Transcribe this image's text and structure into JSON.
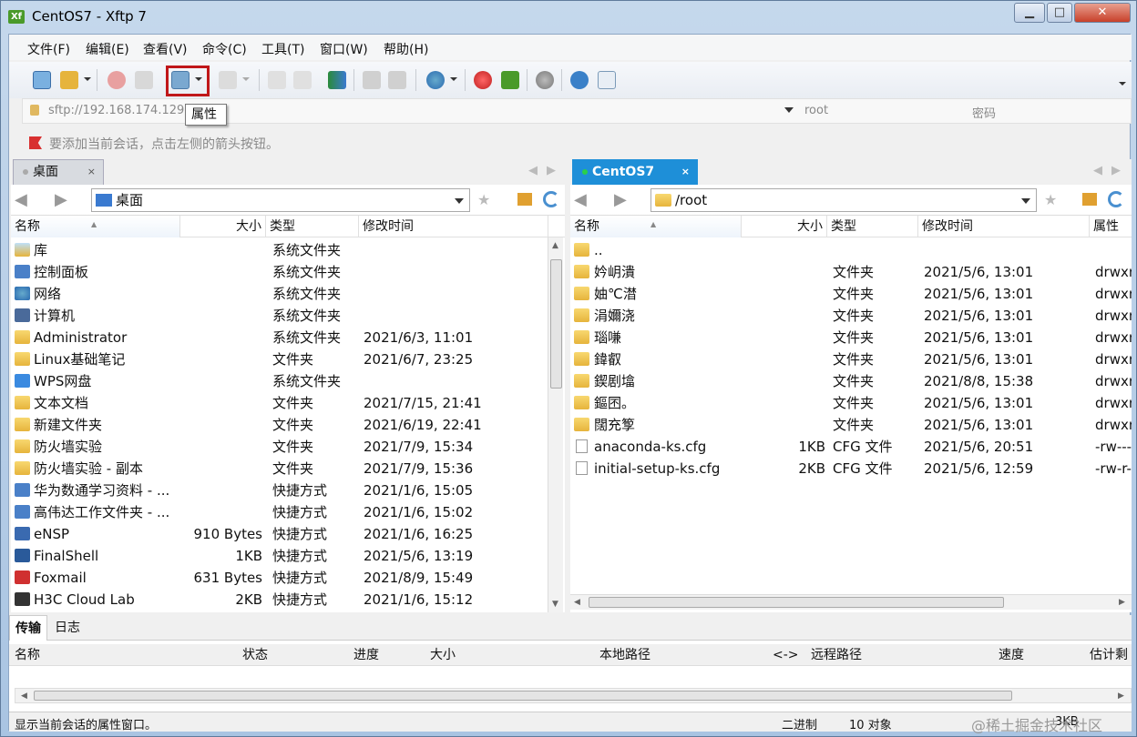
{
  "window": {
    "title": "CentOS7 - Xftp 7",
    "icon_text": "Xf",
    "min": "▁",
    "max": "□",
    "close": "✕"
  },
  "menu": [
    "文件(F)",
    "编辑(E)",
    "查看(V)",
    "命令(C)",
    "工具(T)",
    "窗口(W)",
    "帮助(H)"
  ],
  "tooltip": "属性",
  "address": {
    "host": "sftp://192.168.174.129",
    "user_placeholder": "root",
    "password_placeholder": "密码"
  },
  "info_text": "要添加当前会话，点击左侧的箭头按钮。",
  "left": {
    "tab": {
      "label": "桌面",
      "close": "×"
    },
    "path": "桌面",
    "columns": [
      "名称",
      "大小",
      "类型",
      "修改时间"
    ],
    "rows": [
      {
        "name": "库",
        "size": "",
        "type": "系统文件夹",
        "modified": "",
        "icon": "library-icon"
      },
      {
        "name": "控制面板",
        "size": "",
        "type": "系统文件夹",
        "modified": "",
        "icon": "control-panel-icon"
      },
      {
        "name": "网络",
        "size": "",
        "type": "系统文件夹",
        "modified": "",
        "icon": "network-icon"
      },
      {
        "name": "计算机",
        "size": "",
        "type": "系统文件夹",
        "modified": "",
        "icon": "computer-icon"
      },
      {
        "name": "Administrator",
        "size": "",
        "type": "系统文件夹",
        "modified": "2021/6/3, 11:01",
        "icon": "user-folder-icon"
      },
      {
        "name": "Linux基础笔记",
        "size": "",
        "type": "文件夹",
        "modified": "2021/6/7, 23:25",
        "icon": "folder-icon"
      },
      {
        "name": "WPS网盘",
        "size": "",
        "type": "系统文件夹",
        "modified": "",
        "icon": "cloud-icon"
      },
      {
        "name": "文本文档",
        "size": "",
        "type": "文件夹",
        "modified": "2021/7/15, 21:41",
        "icon": "folder-icon"
      },
      {
        "name": "新建文件夹",
        "size": "",
        "type": "文件夹",
        "modified": "2021/6/19, 22:41",
        "icon": "folder-icon"
      },
      {
        "name": "防火墙实验",
        "size": "",
        "type": "文件夹",
        "modified": "2021/7/9, 15:34",
        "icon": "folder-icon"
      },
      {
        "name": "防火墙实验 - 副本",
        "size": "",
        "type": "文件夹",
        "modified": "2021/7/9, 15:36",
        "icon": "folder-icon"
      },
      {
        "name": "华为数通学习资料 - ...",
        "size": "",
        "type": "快捷方式",
        "modified": "2021/1/6, 15:05",
        "icon": "shortcut-icon"
      },
      {
        "name": "高伟达工作文件夹 - ...",
        "size": "",
        "type": "快捷方式",
        "modified": "2021/1/6, 15:02",
        "icon": "shortcut-icon"
      },
      {
        "name": "eNSP",
        "size": "910 Bytes",
        "type": "快捷方式",
        "modified": "2021/1/6, 16:25",
        "icon": "ensp-icon"
      },
      {
        "name": "FinalShell",
        "size": "1KB",
        "type": "快捷方式",
        "modified": "2021/5/6, 13:19",
        "icon": "finalshell-icon"
      },
      {
        "name": "Foxmail",
        "size": "631 Bytes",
        "type": "快捷方式",
        "modified": "2021/8/9, 15:49",
        "icon": "foxmail-icon"
      },
      {
        "name": "H3C Cloud Lab",
        "size": "2KB",
        "type": "快捷方式",
        "modified": "2021/1/6, 15:12",
        "icon": "h3c-icon"
      }
    ]
  },
  "right": {
    "tab": {
      "label": "CentOS7",
      "close": "×"
    },
    "path": "/root",
    "columns": [
      "名称",
      "大小",
      "类型",
      "修改时间",
      "属性"
    ],
    "rows": [
      {
        "name": "..",
        "size": "",
        "type": "",
        "modified": "",
        "attr": "",
        "kind": "folder"
      },
      {
        "name": "妗岄潰",
        "size": "",
        "type": "文件夹",
        "modified": "2021/5/6, 13:01",
        "attr": "drwxr",
        "kind": "folder"
      },
      {
        "name": "妯℃澘",
        "size": "",
        "type": "文件夹",
        "modified": "2021/5/6, 13:01",
        "attr": "drwxr",
        "kind": "folder"
      },
      {
        "name": "涓嬭浇",
        "size": "",
        "type": "文件夹",
        "modified": "2021/5/6, 13:01",
        "attr": "drwxr",
        "kind": "folder"
      },
      {
        "name": "瑙嗛",
        "size": "",
        "type": "文件夹",
        "modified": "2021/5/6, 13:01",
        "attr": "drwxr",
        "kind": "folder"
      },
      {
        "name": "鍏叡",
        "size": "",
        "type": "文件夹",
        "modified": "2021/5/6, 13:01",
        "attr": "drwxr",
        "kind": "folder"
      },
      {
        "name": "鍥剧墖",
        "size": "",
        "type": "文件夹",
        "modified": "2021/8/8, 15:38",
        "attr": "drwxr",
        "kind": "folder"
      },
      {
        "name": "鏂囨。",
        "size": "",
        "type": "文件夹",
        "modified": "2021/5/6, 13:01",
        "attr": "drwxr",
        "kind": "folder"
      },
      {
        "name": "闊充箰",
        "size": "",
        "type": "文件夹",
        "modified": "2021/5/6, 13:01",
        "attr": "drwxr",
        "kind": "folder"
      },
      {
        "name": "anaconda-ks.cfg",
        "size": "1KB",
        "type": "CFG 文件",
        "modified": "2021/5/6, 20:51",
        "attr": "-rw---",
        "kind": "file"
      },
      {
        "name": "initial-setup-ks.cfg",
        "size": "2KB",
        "type": "CFG 文件",
        "modified": "2021/5/6, 12:59",
        "attr": "-rw-r-",
        "kind": "file"
      }
    ]
  },
  "bottom": {
    "tabs": [
      "传输",
      "日志"
    ],
    "columns": [
      "名称",
      "状态",
      "进度",
      "大小",
      "本地路径",
      "<->",
      "远程路径",
      "速度",
      "估计剩"
    ]
  },
  "status": {
    "left": "显示当前会话的属性窗口。",
    "mode": "二进制",
    "count": "10 对象",
    "size": "3KB",
    "watermark": "@稀土掘金技术社区"
  },
  "colors": {
    "accent": "#1e8fd8",
    "highlight": "#c0171a",
    "folder": "#e6b43c"
  }
}
